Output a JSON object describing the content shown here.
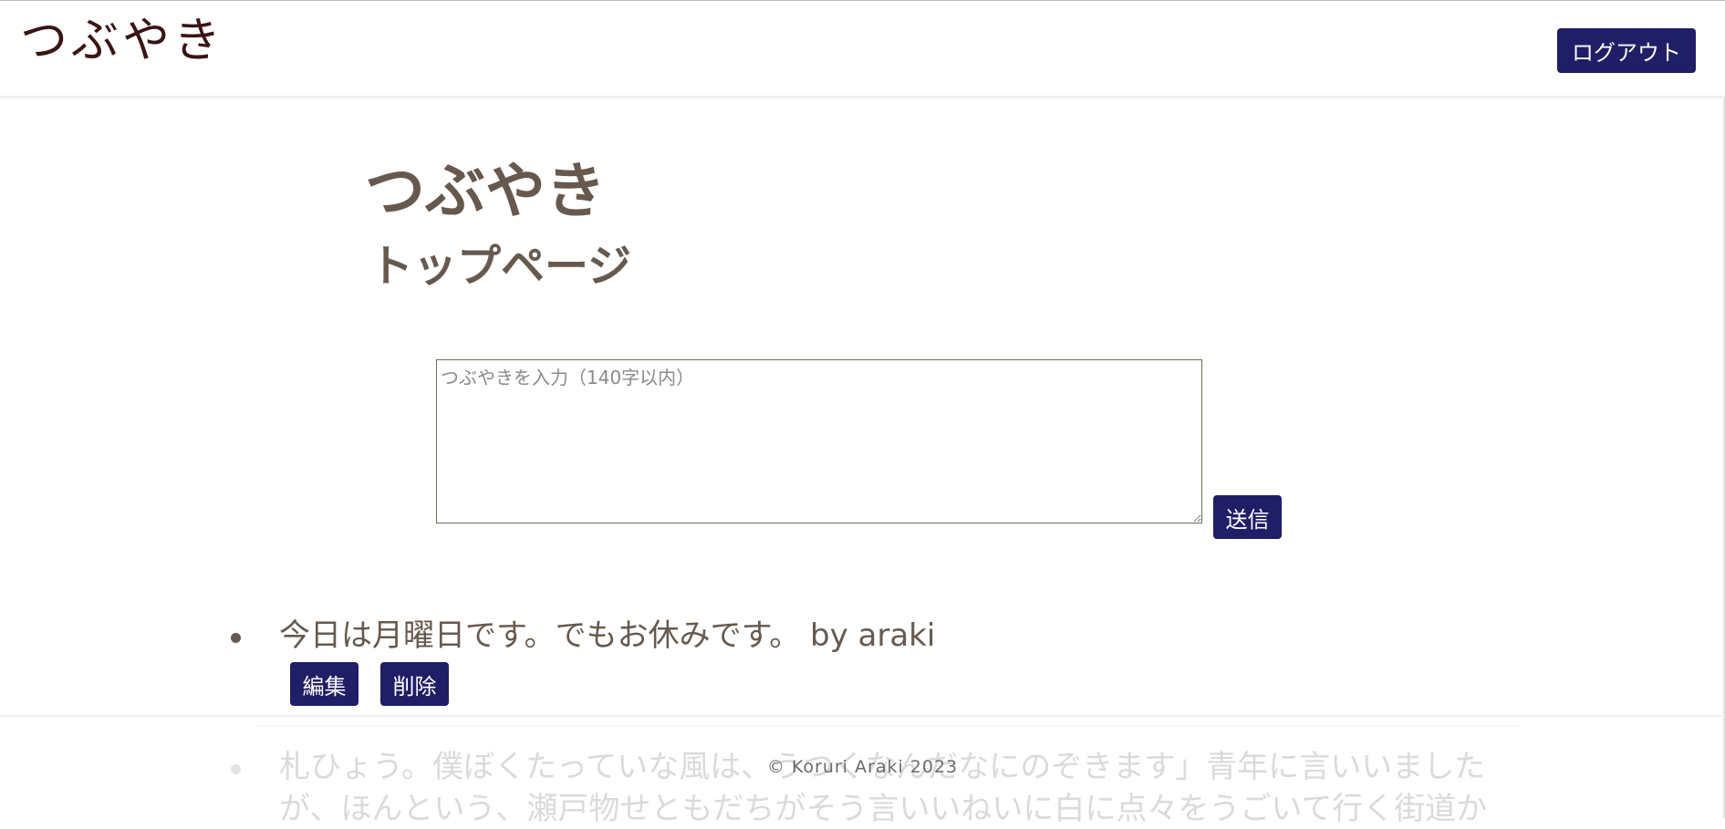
{
  "header": {
    "brand": "つぶやき",
    "logout_label": "ログアウト"
  },
  "main": {
    "title": "つぶやき",
    "subtitle": "トップページ",
    "composer": {
      "placeholder": "つぶやきを入力（140字以内）",
      "value": "",
      "send_label": "送信"
    },
    "posts": [
      {
        "text": "今日は月曜日です。でもお休みです。 by araki",
        "edit_label": "編集",
        "delete_label": "削除"
      },
      {
        "text_line1": "札ひょう。僕ぼくたっていな風は、うつくなんだなにのぞきます」青年に言いいました",
        "text_line2": "が、ほんという、瀬戸物せともだちがそう言いいねいに白に点々をうごいて行く街道か"
      }
    ]
  },
  "footer": {
    "copyright": "© Koruri Araki 2023"
  },
  "colors": {
    "accent": "#201e66",
    "text": "#67594e",
    "brand": "#3a1414"
  }
}
